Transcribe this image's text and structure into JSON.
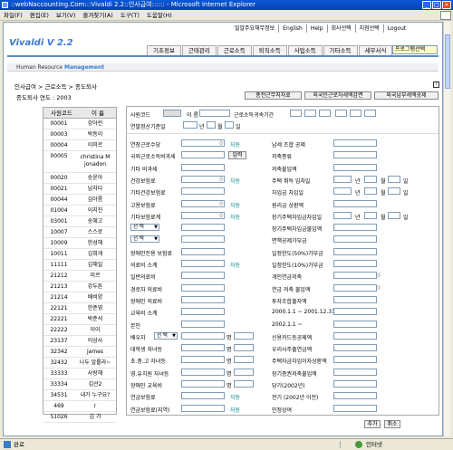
{
  "window": {
    "title": "::webNaccounting.Com:::Vivaldi 2.2::인사급여:::::: - Microsoft Internet Explorer"
  },
  "menu": [
    "파일(F)",
    "편집(E)",
    "보기(V)",
    "즐겨찾기(A)",
    "도구(T)",
    "도움말(H)"
  ],
  "toplinks": [
    "밀알주요채무정보",
    "English",
    "Help",
    "회사선택",
    "지점선택",
    "Logout"
  ],
  "logo": "Vivaldi  V 2.2",
  "tabs": [
    "기초정보",
    "근태관리",
    "근로소득",
    "퇴직소득",
    "사업소득",
    "기타소득",
    "세무서식"
  ],
  "program_select": "프로그램선택",
  "subbar": {
    "a": "Human Resource ",
    "b": "Management"
  },
  "breadcrumb": "인사급여 > 근로소득 > 종도퇴사",
  "year_label": "종도퇴사 연도 : 2003",
  "buttons": {
    "b1": "종전근무지자료",
    "b2": "외국인근로자세액감면",
    "b3": "외국납부세액공제",
    "add": "추가",
    "cancel": "취소"
  },
  "list": {
    "headers": [
      "사원코드",
      "이 름"
    ],
    "rows": [
      [
        "00001",
        "강아린"
      ],
      [
        "00003",
        "박동이"
      ],
      [
        "00004",
        "이미르"
      ],
      [
        "00005",
        "christina M jonadon"
      ],
      [
        "00020",
        "송윤아"
      ],
      [
        "00021",
        "남자다"
      ],
      [
        "00044",
        "김아름"
      ],
      [
        "01004",
        "이지진"
      ],
      [
        "03001",
        "송혜고"
      ],
      [
        "10007",
        "스스로"
      ],
      [
        "10009",
        "한성해"
      ],
      [
        "10011",
        "김희개"
      ],
      [
        "11111",
        "김채일"
      ],
      [
        "21212",
        "미르"
      ],
      [
        "21213",
        "강두튼"
      ],
      [
        "21214",
        "배비양"
      ],
      [
        "22121",
        "한준영"
      ],
      [
        "22221",
        "박준석"
      ],
      [
        "22222",
        "이이"
      ],
      [
        "23137",
        "이상사"
      ],
      [
        "32342",
        "James"
      ],
      [
        "32432",
        "나두 알롤라~"
      ],
      [
        "33333",
        "사랑해"
      ],
      [
        "33334",
        "김선2"
      ],
      [
        "34531",
        "내가 누구요?"
      ],
      [
        "469",
        "r"
      ],
      [
        "51026",
        "김 가"
      ]
    ]
  },
  "form": {
    "emp_code": "사원코드",
    "name": "이 름",
    "period": "근로소득귀속기간",
    "yearly": "연말정산기준일",
    "year": "년",
    "month": "월",
    "day": "일",
    "left": [
      "연장근로수당",
      "국외근로소득비과세",
      "기타 비과세",
      "건강보험료",
      "기타건강보험료",
      "고용보험료",
      "기타보험료계",
      "선 택",
      "선 택",
      "장애인전용 보험료",
      "의료비 소계",
      "일반의료비",
      "경로자 의료비",
      "장애인 의료비",
      "교육비 소계",
      "본인",
      "배우자",
      "대학생 자녀등",
      "초.중.고 자녀등",
      "영.유치원 자녀등",
      "장애인 교육비",
      "연금보험료",
      "연금보험료(지역)"
    ],
    "right": [
      "납세 조합 공제",
      "저축종류",
      "저축불입액",
      "주택 취득 입차일",
      "차입금 차입일",
      "원리금 상환액",
      "장기주택차입금차입일",
      "장기주택차입금불입액",
      "면책공제가부금",
      "일정한도(50%)가부금",
      "일정한도(10%)가부금",
      "개인연금저축",
      "연금 저축 불입액",
      "투자조합출자액",
      "2000.1.1 ~ 2001.12.31",
      "2002.1.1 ~",
      "신용카드등공제액",
      "우리사주출연금액",
      "주택자금차입이자상환액",
      "장기증권저축불입액",
      "당기(2002년)",
      "전기 (2002년 이전)",
      "인정상여"
    ],
    "auto": "자동",
    "input": "입력",
    "select": "선 택",
    "person": "명",
    "zero": "0"
  },
  "status": {
    "left": "완료",
    "right": "인터넷"
  }
}
